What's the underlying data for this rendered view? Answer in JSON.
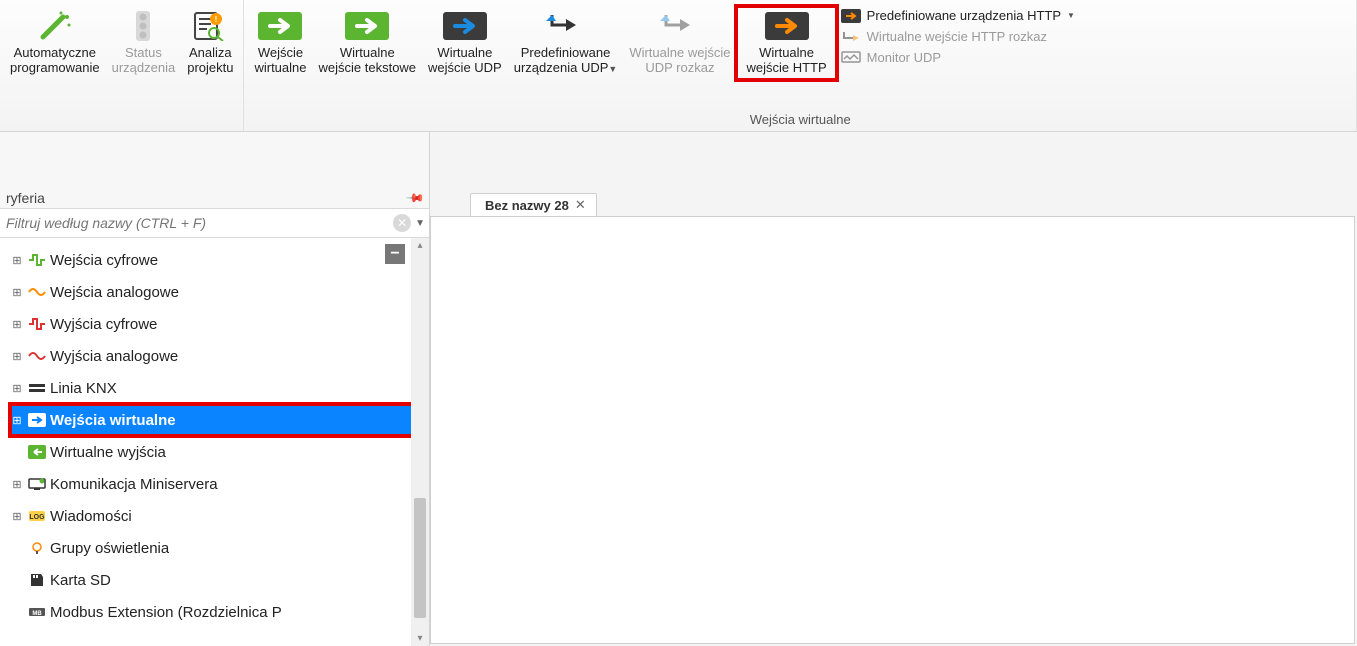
{
  "ribbon": {
    "group1": {
      "btn_auto": "Automatyczne\nprogramowanie",
      "btn_status": "Status\nurządzenia",
      "btn_analysis": "Analiza\nprojektu"
    },
    "group2": {
      "title": "Wejścia wirtualne",
      "btn_vin": "Wejście\nwirtualne",
      "btn_vin_text": "Wirtualne\nwejście tekstowe",
      "btn_vin_udp": "Wirtualne\nwejście UDP",
      "btn_predef_udp": "Predefiniowane\nurządzenia UDP",
      "btn_vin_udp_cmd": "Wirtualne wejście\nUDP rozkaz",
      "btn_vin_http": "Wirtualne\nwejście HTTP",
      "side_predef_http": "Predefiniowane urządzenia HTTP",
      "side_vin_http_cmd": "Wirtualne wejście HTTP rozkaz",
      "side_monitor_udp": "Monitor UDP"
    }
  },
  "panel": {
    "title": "ryferia",
    "filter_placeholder": "Filtruj według nazwy (CTRL + F)"
  },
  "tree": [
    {
      "exp": "⊞",
      "icon": "digital-in",
      "label": "Wejścia cyfrowe"
    },
    {
      "exp": "⊞",
      "icon": "analog-in",
      "label": "Wejścia analogowe"
    },
    {
      "exp": "⊞",
      "icon": "digital-out",
      "label": "Wyjścia cyfrowe"
    },
    {
      "exp": "⊞",
      "icon": "analog-out",
      "label": "Wyjścia analogowe"
    },
    {
      "exp": "⊞",
      "icon": "knx",
      "label": "Linia KNX"
    },
    {
      "exp": "⊞",
      "icon": "vin",
      "label": "Wejścia wirtualne",
      "selected": true
    },
    {
      "exp": "",
      "icon": "vout",
      "label": "Wirtualne wyjścia"
    },
    {
      "exp": "⊞",
      "icon": "comm",
      "label": "Komunikacja Miniservera"
    },
    {
      "exp": "⊞",
      "icon": "msg",
      "label": "Wiadomości"
    },
    {
      "exp": "",
      "icon": "light",
      "label": "Grupy oświetlenia"
    },
    {
      "exp": "",
      "icon": "sd",
      "label": "Karta SD"
    },
    {
      "exp": "",
      "icon": "modbus",
      "label": "Modbus Extension (Rozdzielnica P"
    }
  ],
  "tab": {
    "title": "Bez nazwy 28"
  }
}
